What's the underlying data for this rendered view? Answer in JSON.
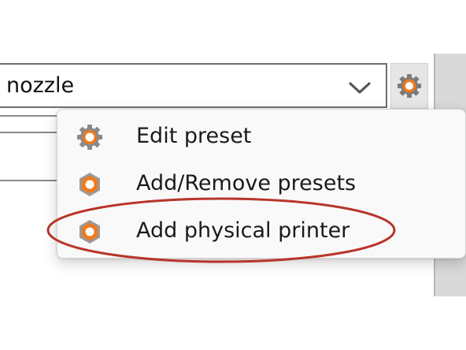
{
  "printer_combo": {
    "value": "nozzle"
  },
  "context_menu": {
    "items": [
      {
        "label": "Edit preset",
        "icon": "gear-icon"
      },
      {
        "label": "Add/Remove presets",
        "icon": "hex-nut-icon"
      },
      {
        "label": "Add physical printer",
        "icon": "hex-nut-icon"
      }
    ]
  },
  "colors": {
    "accent_orange": "#ee7a1e",
    "annotation_red": "#b8352a",
    "menu_bg": "#f9f9f9"
  }
}
